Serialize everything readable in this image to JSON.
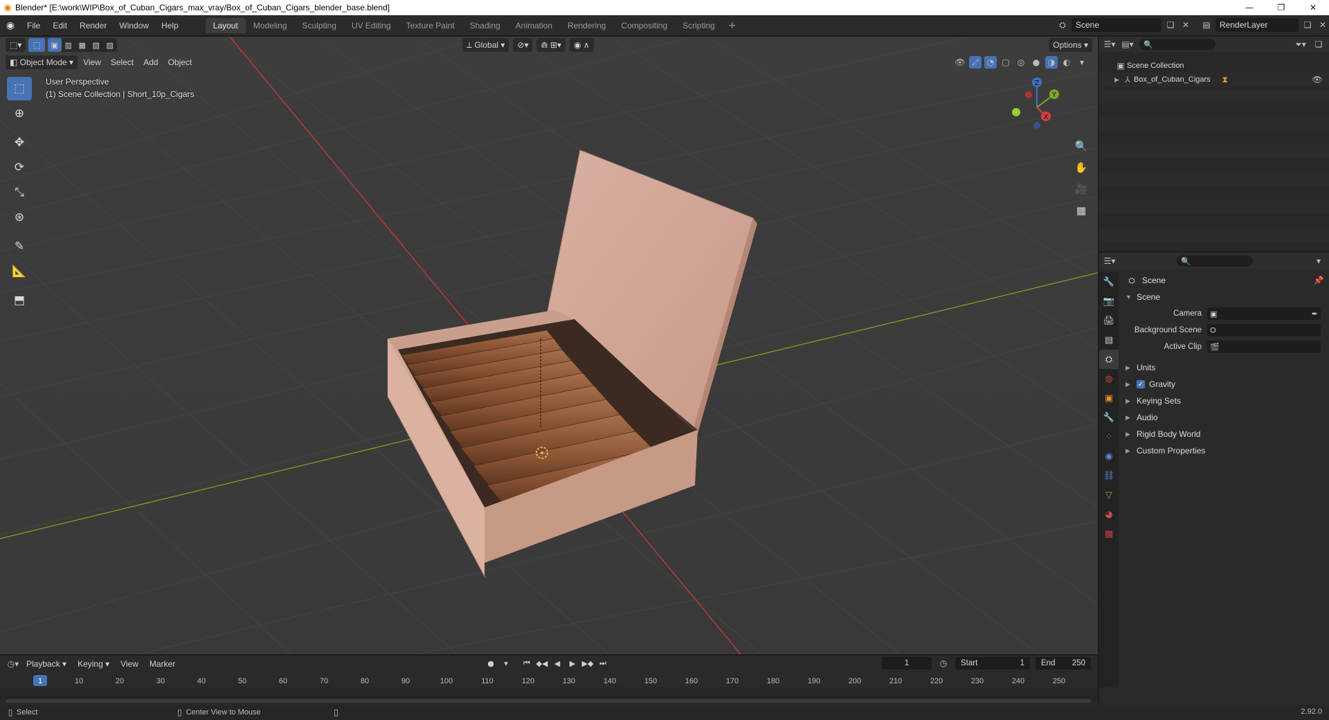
{
  "window": {
    "title": "Blender* [E:\\work\\WIP\\Box_of_Cuban_Cigars_max_vray/Box_of_Cuban_Cigars_blender_base.blend]",
    "controls": [
      "—",
      "❐",
      "✕"
    ]
  },
  "topbar": {
    "menus": [
      "File",
      "Edit",
      "Render",
      "Window",
      "Help"
    ],
    "workspaces": [
      "Layout",
      "Modeling",
      "Sculpting",
      "UV Editing",
      "Texture Paint",
      "Shading",
      "Animation",
      "Rendering",
      "Compositing",
      "Scripting"
    ],
    "active_workspace": "Layout",
    "add_workspace": "+",
    "scene": "Scene",
    "view_layer": "RenderLayer"
  },
  "viewport": {
    "mode": "Object Mode",
    "menus": [
      "View",
      "Select",
      "Add",
      "Object"
    ],
    "transform_orientation": "Global",
    "options_label": "Options",
    "overlay_line1": "User Perspective",
    "overlay_line2": "(1) Scene Collection | Short_10p_Cigars",
    "gizmo": {
      "z": "Z",
      "y": "Y",
      "x": "X"
    },
    "colors": {
      "x_axis": "#d23f3f",
      "y_axis": "#7aa82a",
      "grid_bg": "#3b3b3b",
      "accent": "#4772b3"
    }
  },
  "outliner": {
    "search_placeholder": "",
    "root": "Scene Collection",
    "items": [
      {
        "name": "Box_of_Cuban_Cigars"
      }
    ]
  },
  "properties": {
    "title": "Scene",
    "section": "Scene",
    "fields": [
      {
        "label": "Camera",
        "value": ""
      },
      {
        "label": "Background Scene",
        "value": ""
      },
      {
        "label": "Active Clip",
        "value": ""
      }
    ],
    "subpanels": [
      "Units",
      "Gravity",
      "Keying Sets",
      "Audio",
      "Rigid Body World",
      "Custom Properties"
    ],
    "gravity_checked": true
  },
  "timeline": {
    "menus": [
      "Playback",
      "Keying",
      "View",
      "Marker"
    ],
    "current_frame": "1",
    "start_label": "Start",
    "start": "1",
    "end_label": "End",
    "end": "250",
    "ruler": [
      "1",
      "10",
      "20",
      "30",
      "40",
      "50",
      "60",
      "70",
      "80",
      "90",
      "100",
      "110",
      "120",
      "130",
      "140",
      "150",
      "160",
      "170",
      "180",
      "190",
      "200",
      "210",
      "220",
      "230",
      "240",
      "250"
    ]
  },
  "statusbar": {
    "left": "Select",
    "middle": "Center View to Mouse",
    "version": "2.92.0"
  }
}
